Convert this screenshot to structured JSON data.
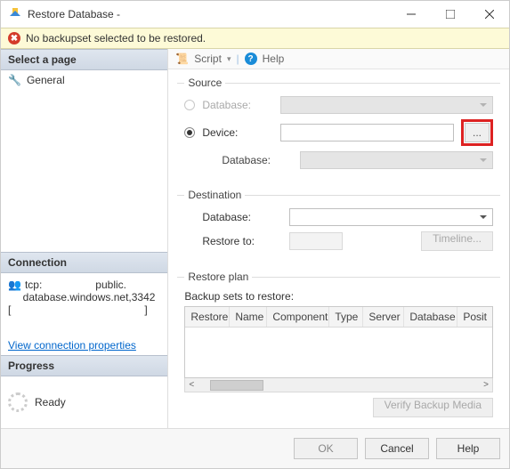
{
  "window": {
    "title": "Restore Database -"
  },
  "errorbar": {
    "message": "No backupset selected to be restored."
  },
  "left": {
    "select_page_header": "Select a page",
    "pages": [
      {
        "label": "General"
      }
    ],
    "connection_header": "Connection",
    "connection_text": "tcp:                  public.\n     database.windows.net,3342\n[                                             ]",
    "connection_link": "View connection properties",
    "progress_header": "Progress",
    "progress_status": "Ready"
  },
  "toolbar": {
    "script": "Script",
    "help": "Help"
  },
  "source": {
    "legend": "Source",
    "database_label": "Database:",
    "device_label": "Device:",
    "sub_database_label": "Database:",
    "selected": "device",
    "browse_label": "..."
  },
  "destination": {
    "legend": "Destination",
    "database_label": "Database:",
    "restore_to_label": "Restore to:",
    "timeline_label": "Timeline..."
  },
  "restore_plan": {
    "legend": "Restore plan",
    "sets_label": "Backup sets to restore:",
    "columns": [
      "Restore",
      "Name",
      "Component",
      "Type",
      "Server",
      "Database",
      "Posit"
    ],
    "verify_label": "Verify Backup Media"
  },
  "footer": {
    "ok": "OK",
    "cancel": "Cancel",
    "help": "Help"
  }
}
